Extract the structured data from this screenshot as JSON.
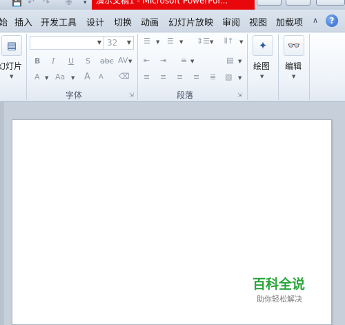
{
  "title_bar": {
    "window_title": "演示文稿1 - Microsoft PowerPoi..."
  },
  "tabs": [
    {
      "label": "始"
    },
    {
      "label": "插入"
    },
    {
      "label": "开发工具"
    },
    {
      "label": "设计"
    },
    {
      "label": "切换"
    },
    {
      "label": "动画"
    },
    {
      "label": "幻灯片放映"
    },
    {
      "label": "审阅"
    },
    {
      "label": "视图"
    },
    {
      "label": "加载项"
    }
  ],
  "ribbon": {
    "slides_group": {
      "new_slide_label": "幻灯片"
    },
    "font_group": {
      "label": "字体",
      "font_name": "",
      "font_size": "32",
      "bold": "B",
      "italic": "I",
      "underline": "U",
      "shadow": "S",
      "strike": "abc",
      "spacing": "AV",
      "font_color": "A",
      "change_case": "Aa",
      "grow": "A",
      "shrink": "A"
    },
    "paragraph_group": {
      "label": "段落"
    },
    "drawing_group": {
      "label": "绘图"
    },
    "editing_group": {
      "label": "编辑"
    }
  },
  "watermark": {
    "title": "百科全说",
    "subtitle": "助你轻松解决"
  },
  "colors": {
    "title_red": "#e8080c",
    "watermark_green": "#2aa43a"
  }
}
